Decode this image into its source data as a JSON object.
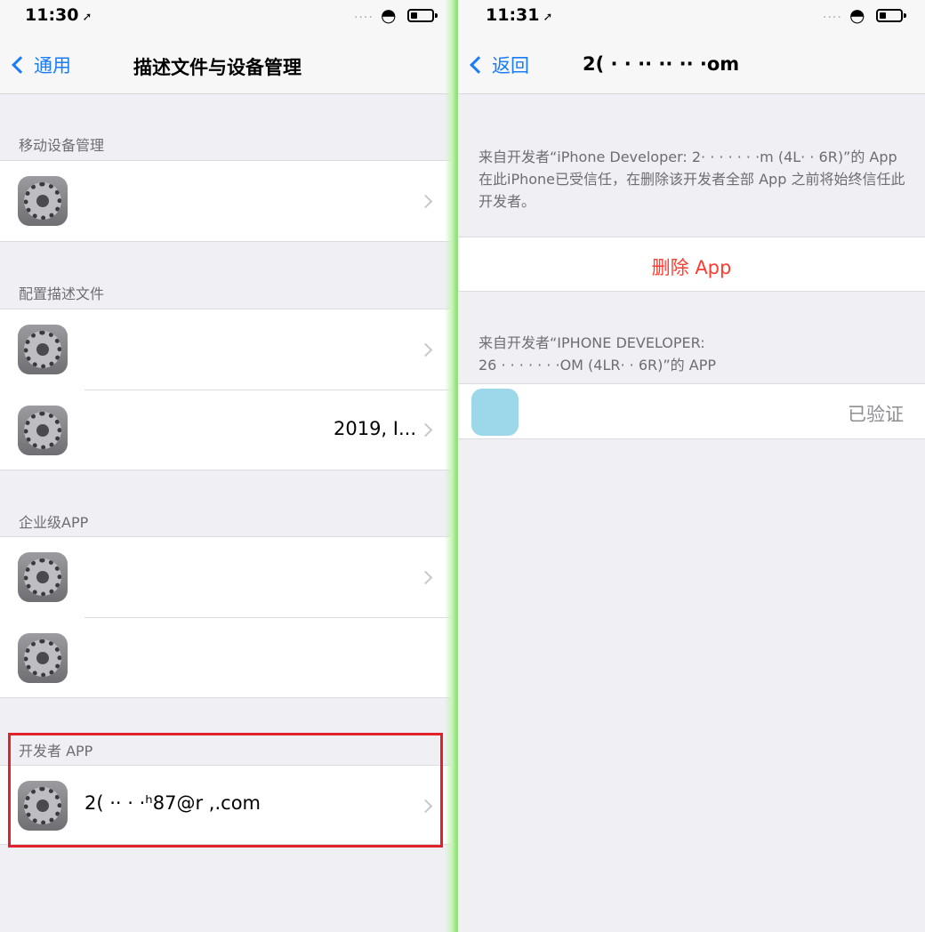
{
  "left": {
    "status": {
      "time": "11:30",
      "arrow": "➚",
      "signal": "....",
      "wifi": "◓"
    },
    "nav": {
      "back_label": "通用",
      "title": "描述文件与设备管理"
    },
    "sections": {
      "mdm": {
        "header": "移动设备管理",
        "items": [
          {
            "title": "",
            "subtitle": ""
          }
        ]
      },
      "profiles": {
        "header": "配置描述文件",
        "items": [
          {
            "title": ""
          },
          {
            "title": "2019, I..."
          }
        ]
      },
      "enterprise": {
        "header": "企业级APP",
        "items": [
          {
            "title": ""
          },
          {
            "title": ""
          }
        ]
      },
      "developer": {
        "header": "开发者 APP",
        "items": [
          {
            "title": "2( ·· · ·ʰ87@r ,.com"
          }
        ]
      }
    }
  },
  "right": {
    "status": {
      "time": "11:31",
      "arrow": "➚",
      "signal": "....",
      "wifi": "◓"
    },
    "nav": {
      "back_label": "返回",
      "title": "2( · · ·· ·· ·· ·om"
    },
    "trust_info": "来自开发者“iPhone Developer: 2· · · · · · ·m (4L· · 6R)”的 App 在此iPhone已受信任，在删除该开发者全部 App 之前将始终信任此开发者。",
    "delete_button": "删除 App",
    "apps_header_line1": "来自开发者“IPHONE DEVELOPER:",
    "apps_header_line2": "26 · · · · · · ·OM (4LR· · 6R)”的 APP",
    "app": {
      "name": "",
      "status": "已验证"
    }
  },
  "colors": {
    "accent": "#1a7cf5",
    "destructive": "#ff3b30",
    "highlight": "#e0222a",
    "divider": "#8ee07a"
  }
}
